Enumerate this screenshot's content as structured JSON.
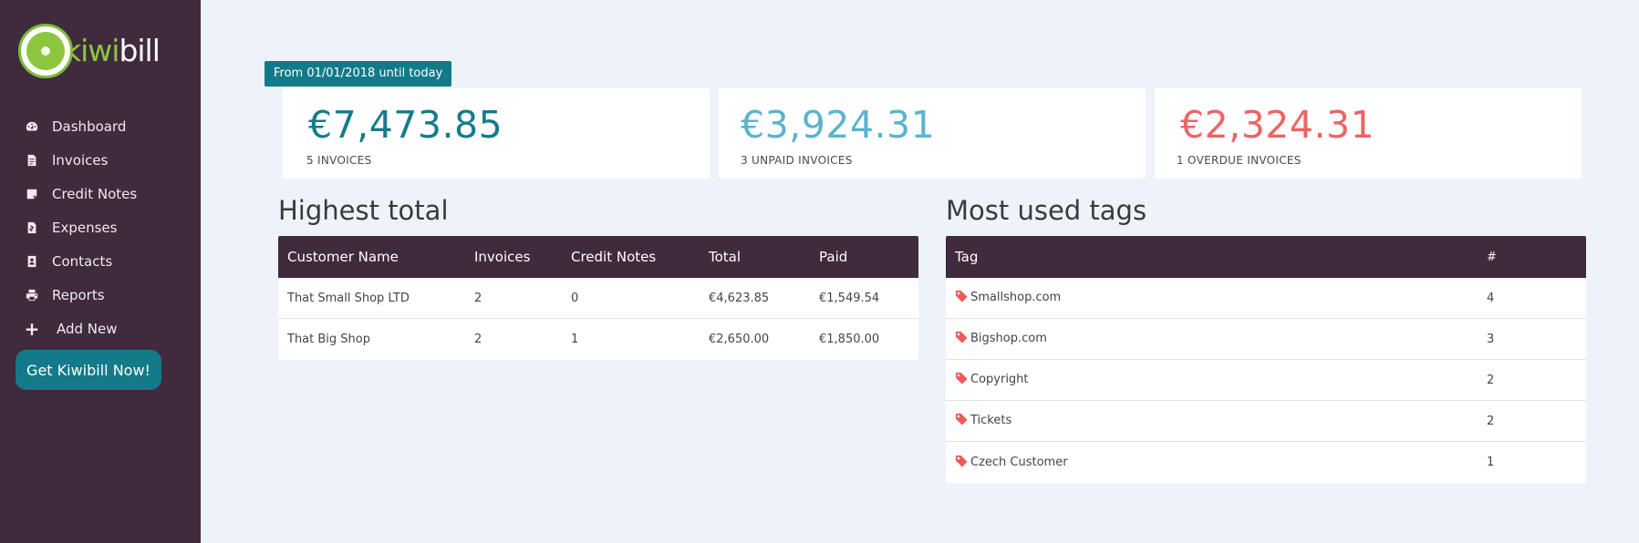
{
  "brand": {
    "logo_part1": "kiwi",
    "logo_part2": "bill",
    "accent": "#8cc63f"
  },
  "sidebar": {
    "items": [
      {
        "label": "Dashboard",
        "icon": "dashboard-icon"
      },
      {
        "label": "Invoices",
        "icon": "file-icon"
      },
      {
        "label": "Credit Notes",
        "icon": "note-icon"
      },
      {
        "label": "Expenses",
        "icon": "receipt-icon"
      },
      {
        "label": "Contacts",
        "icon": "contact-card-icon"
      },
      {
        "label": "Reports",
        "icon": "printer-icon"
      },
      {
        "label": "Add New",
        "icon": "plus-icon"
      }
    ],
    "cta_label": "Get Kiwibill Now!"
  },
  "date_range": "From 01/01/2018 until today",
  "stats": [
    {
      "value": "€7,473.85",
      "label": "5 INVOICES",
      "color": "#147c8b"
    },
    {
      "value": "€3,924.31",
      "label": "3 UNPAID INVOICES",
      "color": "#5ab4d0"
    },
    {
      "value": "€2,324.31",
      "label": "1 OVERDUE INVOICES",
      "color": "#ee6464"
    }
  ],
  "highest_total": {
    "title": "Highest total",
    "columns": [
      "Customer Name",
      "Invoices",
      "Credit Notes",
      "Total",
      "Paid"
    ],
    "rows": [
      [
        "That Small Shop LTD",
        "2",
        "0",
        "€4,623.85",
        "€1,549.54"
      ],
      [
        "That Big Shop",
        "2",
        "1",
        "€2,650.00",
        "€1,850.00"
      ]
    ]
  },
  "most_used_tags": {
    "title": "Most used tags",
    "columns": [
      "Tag",
      "#"
    ],
    "rows": [
      [
        "Smallshop.com",
        "4"
      ],
      [
        "Bigshop.com",
        "3"
      ],
      [
        "Copyright",
        "2"
      ],
      [
        "Tickets",
        "2"
      ],
      [
        "Czech Customer",
        "1"
      ]
    ]
  }
}
